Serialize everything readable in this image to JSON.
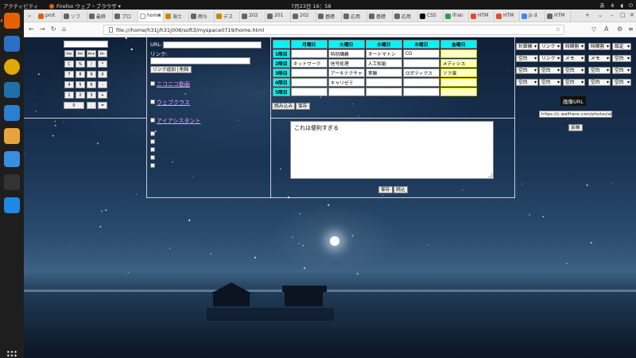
{
  "system_bar": {
    "activities": "アクティビティ",
    "app_name": "Firefox ウェブ・ブラウザ",
    "clock": "7月23日 16：58",
    "input_method": "あ",
    "indicators": [
      "network-icon",
      "volume-icon",
      "power-icon"
    ]
  },
  "dock": {
    "items": [
      {
        "name": "firefox-icon",
        "color": "#e66000"
      },
      {
        "name": "thunderbird-icon",
        "color": "#2b6fc7"
      },
      {
        "name": "rhythmbox-icon",
        "color": "#e0a800"
      },
      {
        "name": "libreoffice-impress-icon",
        "color": "#1f6fa8"
      },
      {
        "name": "libreoffice-writer-icon",
        "color": "#2a7fd0"
      },
      {
        "name": "files-icon",
        "color": "#e8a33a"
      },
      {
        "name": "help-icon",
        "color": "#3a8ee0"
      },
      {
        "name": "terminal-icon",
        "color": "#333333"
      },
      {
        "name": "vscode-icon",
        "color": "#1e88e5"
      }
    ],
    "app_grid": "app-grid-icon"
  },
  "tabs": [
    {
      "label": "prot",
      "color": "#e66000"
    },
    {
      "label": "ソフ",
      "color": "#666666"
    },
    {
      "label": "最終",
      "color": "#666666"
    },
    {
      "label": "プロ",
      "color": "#666666"
    },
    {
      "label": "home",
      "color": "#ffffff",
      "active": true
    },
    {
      "label": "海士",
      "color": "#cc8800"
    },
    {
      "label": "雨ち",
      "color": "#666666"
    },
    {
      "label": "デス",
      "color": "#cc8800"
    },
    {
      "label": "202",
      "color": "#666666"
    },
    {
      "label": "201",
      "color": "#666666"
    },
    {
      "label": "202",
      "color": "#666666"
    },
    {
      "label": "基礎",
      "color": "#666666"
    },
    {
      "label": "応用",
      "color": "#666666"
    },
    {
      "label": "基礎",
      "color": "#666666"
    },
    {
      "label": "応用",
      "color": "#666666"
    },
    {
      "label": "CSS",
      "color": "#000000"
    },
    {
      "label": "ifran",
      "color": "#2e9e44"
    },
    {
      "label": "HTM",
      "color": "#e44d26"
    },
    {
      "label": "HTM",
      "color": "#e44d26"
    },
    {
      "label": "js d",
      "color": "#4285f4"
    },
    {
      "label": "HTM",
      "color": "#666666"
    }
  ],
  "nav": {
    "url": "file:///home/h31j/h31j008/soft3/myspace0719/home.html"
  },
  "calculator": {
    "keys": [
      "mc",
      "mr",
      "m+",
      "m-",
      "C",
      "%",
      "/",
      "*",
      "7",
      "8",
      "9",
      "X",
      "4",
      "5",
      "6",
      "-",
      "1",
      "2",
      "3",
      "+",
      "0",
      ".",
      "="
    ]
  },
  "link_panel": {
    "url_label": "URL:",
    "link_label": "リンク:",
    "add_button": "リンク追加",
    "delete_button": "削除",
    "links": [
      "ニコニコ動画",
      "ウェブクラス",
      "アイアシスタント"
    ]
  },
  "timetable": {
    "days": [
      "月曜日",
      "火曜日",
      "水曜日",
      "木曜日",
      "金曜日"
    ],
    "rows": [
      {
        "period": "1限目",
        "cells": [
          "",
          "特別講義",
          "オートマトン",
          "CG",
          ""
        ]
      },
      {
        "period": "2限目",
        "cells": [
          "ネットワーク",
          "信号処理",
          "人工知能",
          "",
          "メディシス"
        ]
      },
      {
        "period": "3限目",
        "cells": [
          "",
          "アーキテクチャ",
          "実験",
          "ロボティクス",
          "ソフ演"
        ]
      },
      {
        "period": "4限目",
        "cells": [
          "",
          "キャリゼミ",
          "",
          "",
          ""
        ]
      },
      {
        "period": "5限目",
        "cells": [
          "",
          "",
          "",
          "",
          ""
        ]
      }
    ],
    "load_button": "読み込み",
    "save_button": "保存"
  },
  "memo": {
    "text": "これは便利すぎる",
    "save_button": "保存",
    "load_button": "読込"
  },
  "right_panel": {
    "row1": [
      "計算機",
      "リンク",
      "時間割",
      "時間割",
      "設定"
    ],
    "row2": [
      "空白",
      "リンク",
      "メモ",
      "メモ",
      "空白"
    ],
    "row3": [
      "空白",
      "空白",
      "空白",
      "空白",
      "空白"
    ],
    "row4": [
      "空白",
      "空白",
      "空白",
      "空白",
      "空白"
    ],
    "image_url_label": "画像URL",
    "image_url_value": "https://c.wallhere.com/photos/ab",
    "reflect_button": "反映"
  }
}
